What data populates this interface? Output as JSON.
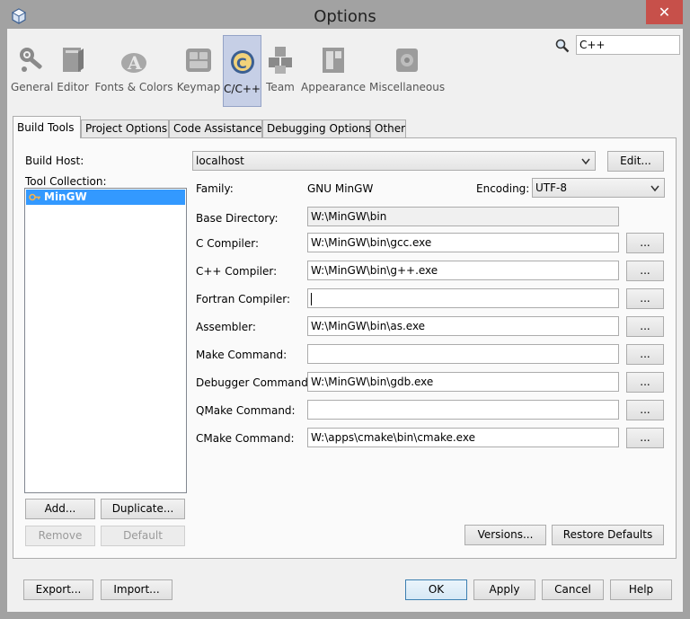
{
  "window": {
    "title": "Options",
    "close_glyph": "✕"
  },
  "categories": [
    {
      "label": "General",
      "icon": "general-icon"
    },
    {
      "label": "Editor",
      "icon": "editor-icon"
    },
    {
      "label": "Fonts & Colors",
      "icon": "fonts-colors-icon"
    },
    {
      "label": "Keymap",
      "icon": "keymap-icon"
    },
    {
      "label": "C/C++",
      "icon": "cpp-icon",
      "selected": true
    },
    {
      "label": "Team",
      "icon": "team-icon"
    },
    {
      "label": "Appearance",
      "icon": "appearance-icon"
    },
    {
      "label": "Miscellaneous",
      "icon": "miscellaneous-icon"
    }
  ],
  "search": {
    "value": "C++",
    "icon": "search-icon"
  },
  "tabs": [
    {
      "label": "Build Tools",
      "active": true
    },
    {
      "label": "Project Options"
    },
    {
      "label": "Code Assistance"
    },
    {
      "label": "Debugging Options"
    },
    {
      "label": "Other"
    }
  ],
  "build": {
    "host_label": "Build Host:",
    "host_value": "localhost",
    "edit_label": "Edit...",
    "tool_collection_label": "Tool Collection:",
    "tool_collection_items": [
      "MinGW"
    ],
    "family_label": "Family:",
    "family_value": "GNU MinGW",
    "encoding_label": "Encoding:",
    "encoding_value": "UTF-8",
    "fields": [
      {
        "label": "Base Directory:",
        "value": "W:\\MinGW\\bin",
        "readonly": true
      },
      {
        "label": "C Compiler:",
        "value": "W:\\MinGW\\bin\\gcc.exe"
      },
      {
        "label": "C++ Compiler:",
        "value": "W:\\MinGW\\bin\\g++.exe"
      },
      {
        "label": "Fortran Compiler:",
        "value": "",
        "focused": true
      },
      {
        "label": "Assembler:",
        "value": "W:\\MinGW\\bin\\as.exe"
      },
      {
        "label": "Make Command:",
        "value": ""
      },
      {
        "label": "Debugger Command:",
        "value": "W:\\MinGW\\bin\\gdb.exe"
      },
      {
        "label": "QMake Command:",
        "value": ""
      },
      {
        "label": "CMake Command:",
        "value": "W:\\apps\\cmake\\bin\\cmake.exe"
      }
    ],
    "browse_label": "...",
    "add_label": "Add...",
    "duplicate_label": "Duplicate...",
    "remove_label": "Remove",
    "default_label": "Default",
    "versions_label": "Versions...",
    "restore_defaults_label": "Restore Defaults"
  },
  "footer": {
    "export_label": "Export...",
    "import_label": "Import...",
    "ok_label": "OK",
    "apply_label": "Apply",
    "cancel_label": "Cancel",
    "help_label": "Help"
  },
  "colors": {
    "selection": "#3399ff",
    "close_button": "#c7504a",
    "selected_category": "#c6cfe6"
  }
}
